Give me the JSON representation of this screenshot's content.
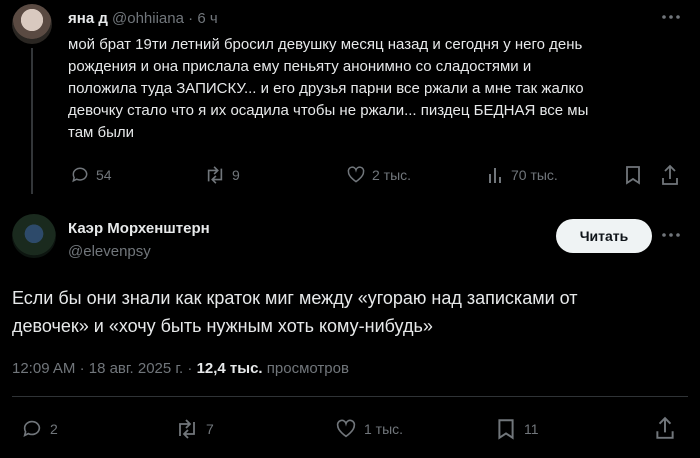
{
  "quoted": {
    "name": "яна д",
    "handle": "@ohhiiana",
    "time": "6 ч",
    "lines": [
      "мой брат 19ти летний бросил девушку месяц назад и сегодня у него день",
      "рождения и она прислала ему пеньяту анонимно со сладостями и",
      "положила туда ЗАПИСКУ... и его друзья парни все ржали а мне так жалко",
      "девочку стало что я их осадила чтобы не ржали... пиздец БЕДНАЯ все мы",
      "там были"
    ],
    "replies": "54",
    "reposts": "9",
    "likes": "2 тыс.",
    "views": "70 тыс."
  },
  "main": {
    "name": "Каэр Морхенштерн",
    "handle": "@elevenpsy",
    "follow_label": "Читать",
    "text_lines": [
      "Если бы они знали как краток миг между «угораю над записками от",
      "девочек» и «хочу быть нужным хоть кому-нибудь»"
    ],
    "time": "12:09 AM",
    "date": "18 авг. 2025 г.",
    "views_count": "12,4 тыс.",
    "views_label": "просмотров",
    "replies": "2",
    "reposts": "7",
    "likes": "1 тыс.",
    "bookmarks": "11"
  },
  "colors": {
    "background": "#000000",
    "text": "#e7e9ea",
    "muted": "#71767b",
    "divider": "#2f3336",
    "button_bg": "#eff3f4"
  }
}
